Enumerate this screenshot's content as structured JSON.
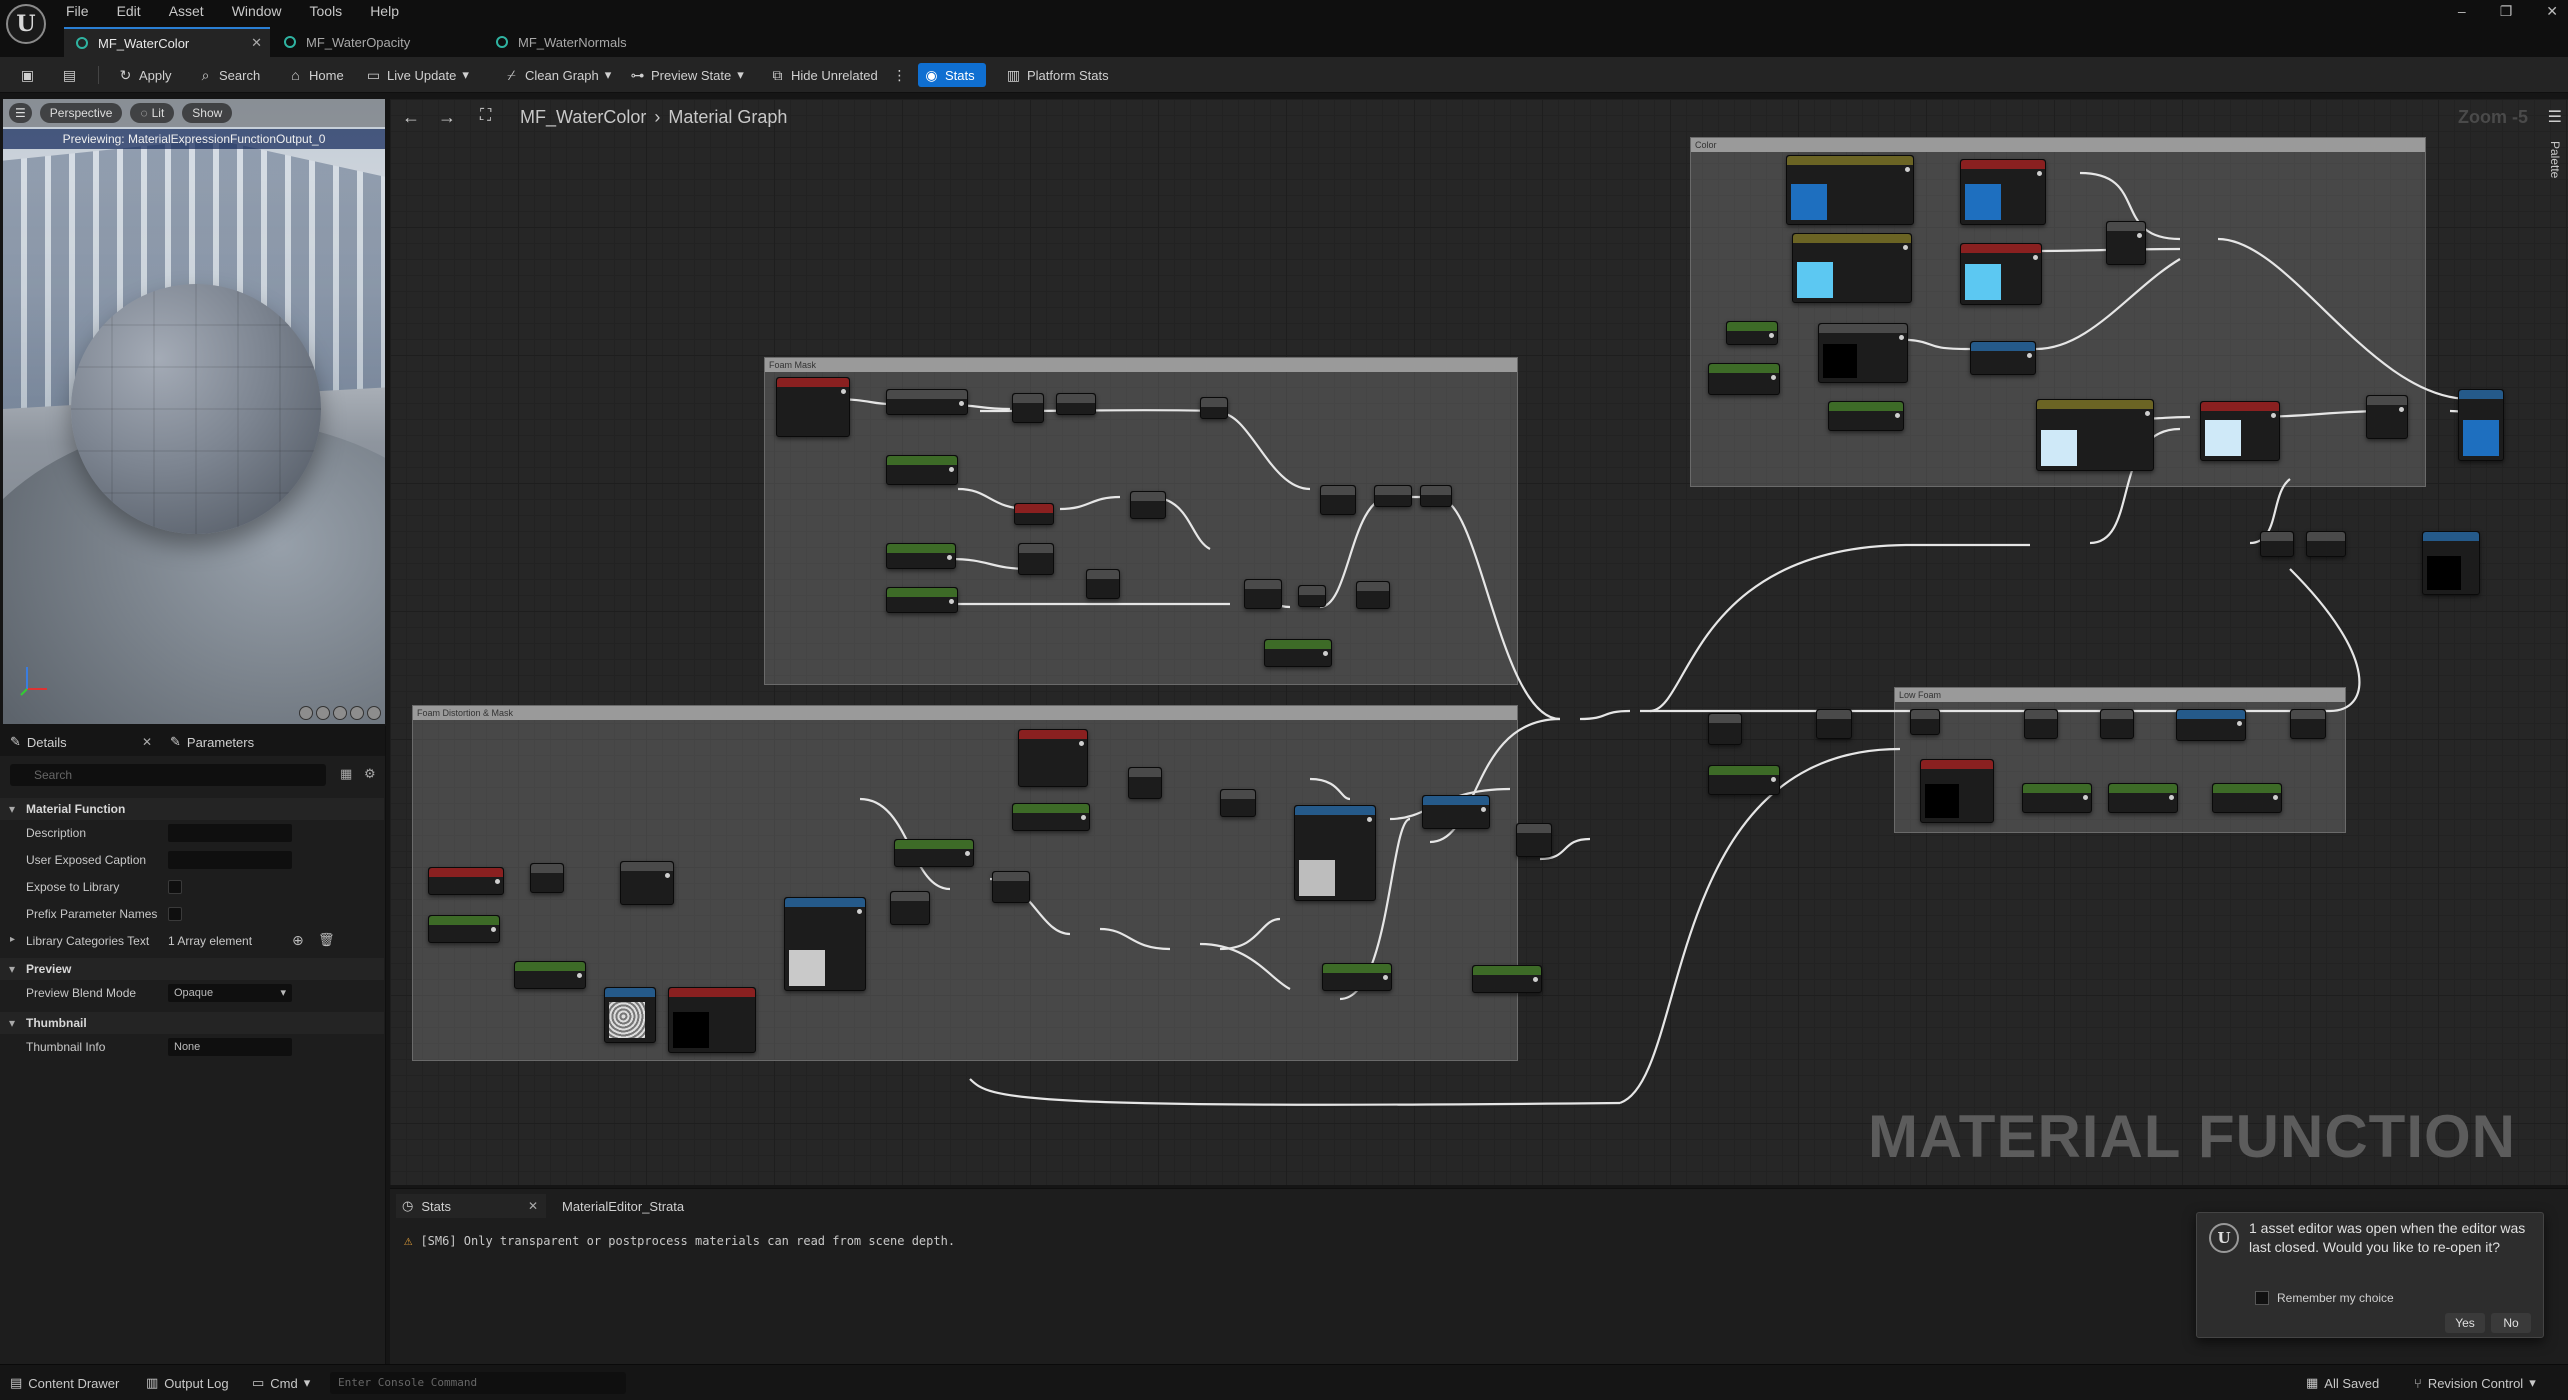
{
  "menu": {
    "items": [
      "File",
      "Edit",
      "Asset",
      "Window",
      "Tools",
      "Help"
    ]
  },
  "window_controls": {
    "minimize": "–",
    "restore": "❐",
    "close": "✕"
  },
  "tabs": [
    {
      "label": "MF_WaterColor",
      "active": true
    },
    {
      "label": "MF_WaterOpacity",
      "active": false
    },
    {
      "label": "MF_WaterNormals",
      "active": false
    }
  ],
  "toolbar": {
    "apply": "Apply",
    "search": "Search",
    "home": "Home",
    "live_update": "Live Update",
    "clean_graph": "Clean Graph",
    "preview_state": "Preview State",
    "hide_unrelated": "Hide Unrelated",
    "stats": "Stats",
    "platform_stats": "Platform Stats"
  },
  "viewport": {
    "perspective": "Perspective",
    "lit": "Lit",
    "show": "Show",
    "previewing": "Previewing: MaterialExpressionFunctionOutput_0"
  },
  "details": {
    "tab_details": "Details",
    "tab_parameters": "Parameters",
    "search_placeholder": "Search",
    "categories": {
      "material_function": "Material Function",
      "preview": "Preview",
      "thumbnail": "Thumbnail"
    },
    "rows": {
      "description": "Description",
      "user_exposed_caption": "User Exposed Caption",
      "expose_to_library": "Expose to Library",
      "prefix_parameter_names": "Prefix Parameter Names",
      "library_categories_text": "Library Categories Text",
      "library_categories_value": "1 Array element",
      "preview_blend_mode": "Preview Blend Mode",
      "preview_blend_mode_value": "Opaque",
      "thumbnail_info": "Thumbnail Info",
      "thumbnail_info_value": "None"
    }
  },
  "graph": {
    "breadcrumb_asset": "MF_WaterColor",
    "breadcrumb_sep": "›",
    "breadcrumb_graph": "Material Graph",
    "zoom": "Zoom -5",
    "palette": "Palette",
    "watermark": "MATERIAL FUNCTION",
    "comments": {
      "color": "Color",
      "foam_mask": "Foam Mask",
      "foam_distortion": "Foam Distortion & Mask",
      "low_foam": "Low Foam"
    },
    "colors": {
      "blue_dark": "#1e6fbf",
      "blue_light": "#5cc8f2",
      "node_green": "#3d6b27",
      "node_red": "#8a2020",
      "node_blue": "#255a8a"
    }
  },
  "bottom": {
    "tab_stats": "Stats",
    "tab_strata": "MaterialEditor_Strata",
    "message": "[SM6] Only transparent or postprocess materials can read from scene depth."
  },
  "notification": {
    "text": "1 asset editor was open when the editor was last closed. Would you like to re-open it?",
    "remember": "Remember my choice",
    "yes": "Yes",
    "no": "No"
  },
  "statusbar": {
    "content_drawer": "Content Drawer",
    "output_log": "Output Log",
    "cmd": "Cmd",
    "console_placeholder": "Enter Console Command",
    "all_saved": "All Saved",
    "revision_control": "Revision Control"
  }
}
